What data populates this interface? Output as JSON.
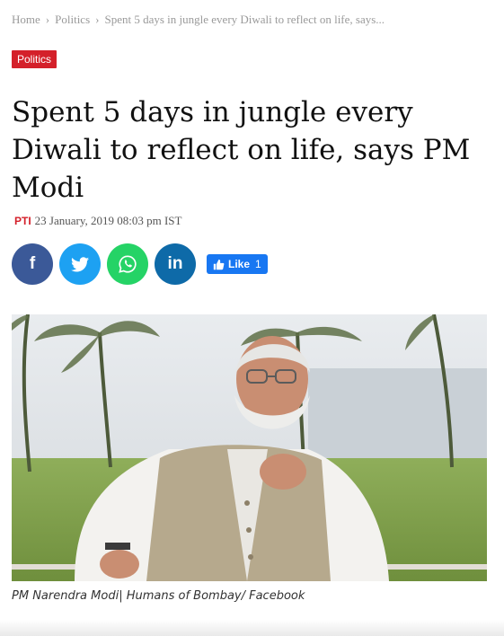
{
  "breadcrumb": {
    "home": "Home",
    "section": "Politics",
    "current": "Spent 5 days in jungle every Diwali to reflect on life, says..."
  },
  "article": {
    "category": "Politics",
    "headline": "Spent 5 days in jungle every Diwali to reflect on life, says PM Modi",
    "author": "PTI",
    "date": "23 January, 2019 08:03 pm IST",
    "caption": "PM Narendra Modi| Humans of Bombay/ Facebook"
  },
  "share": {
    "facebook": "f",
    "linkedin": "in",
    "like_label": "Like",
    "like_count": "1"
  },
  "colors": {
    "accent": "#d4202a",
    "facebook": "#3b5998",
    "twitter": "#1da1f2",
    "whatsapp": "#25d366",
    "linkedin": "#0e6aa8",
    "like": "#1877f2"
  },
  "icons": [
    "chevron-right-icon",
    "twitter-bird-icon",
    "whatsapp-icon",
    "thumbs-up-icon"
  ]
}
